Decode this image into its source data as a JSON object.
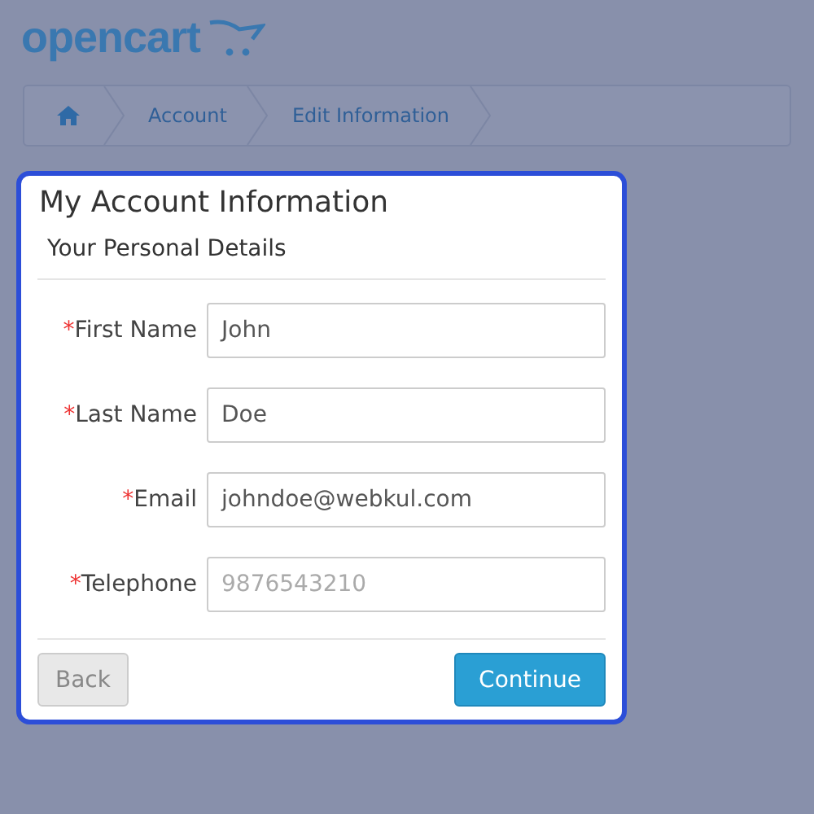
{
  "logo": {
    "text": "opencart"
  },
  "breadcrumb": [
    {
      "kind": "home"
    },
    {
      "kind": "link",
      "label": "Account"
    },
    {
      "kind": "link",
      "label": "Edit Information"
    }
  ],
  "dialog": {
    "title": "My Account Information",
    "section": "Your Personal Details",
    "fields": [
      {
        "mark": "*",
        "label": "First Name",
        "value": "John",
        "blurred": false
      },
      {
        "mark": "*",
        "label": "Last Name",
        "value": "Doe",
        "blurred": false
      },
      {
        "mark": "*",
        "label": "Email",
        "value": "johndoe@webkul.com",
        "blurred": false
      },
      {
        "mark": "*",
        "label": "Telephone",
        "value": "9876543210",
        "blurred": true
      }
    ],
    "buttons": [
      {
        "kind": "secondary",
        "label": "Back"
      },
      {
        "kind": "primary",
        "label": "Continue"
      }
    ]
  }
}
